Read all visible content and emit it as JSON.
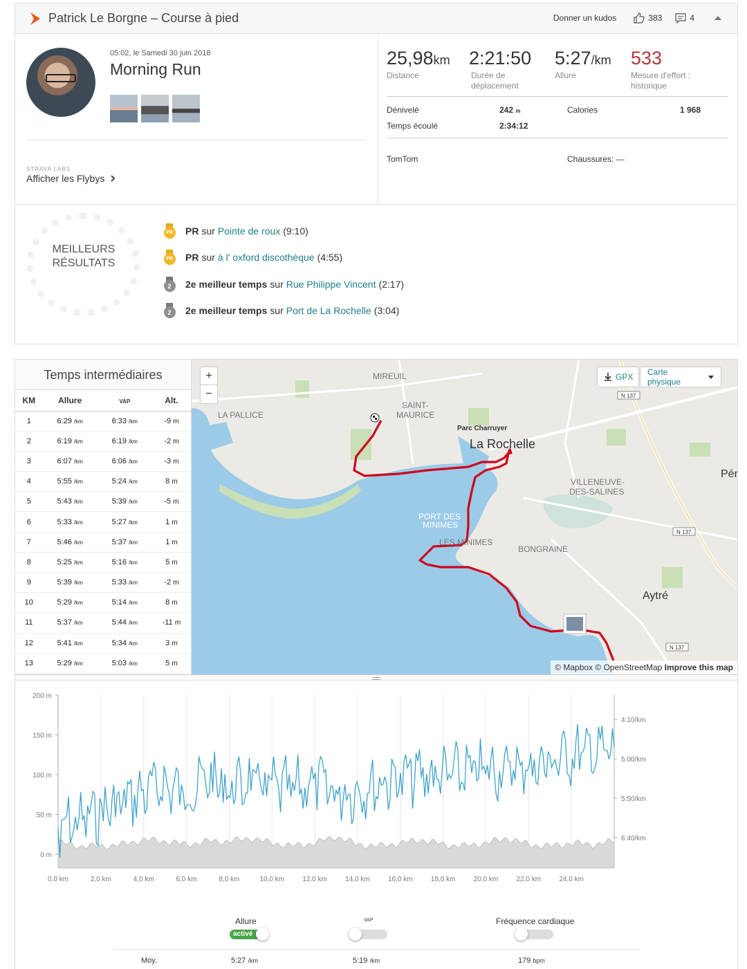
{
  "header": {
    "title": "Patrick Le Borgne – Course à pied",
    "kudos_label": "Donner un kudos",
    "kudos_count": "383",
    "comments_count": "4"
  },
  "activity": {
    "date": "05:02, le Samedi 30 juin 2018",
    "title": "Morning Run",
    "labs_label": "STRAVA LABS",
    "flybys_label": "Afficher les Flybys"
  },
  "stats": {
    "distance": {
      "value": "25,98",
      "unit": "km",
      "label": "Distance"
    },
    "moving_time": {
      "value": "2:21:50",
      "label": "Durée de déplacement"
    },
    "pace": {
      "value": "5:27",
      "unit": "/km",
      "label": "Allure"
    },
    "effort": {
      "value": "533",
      "label": "Mesure d'effort : historique"
    },
    "elevation": {
      "label": "Dénivelé",
      "value": "242",
      "unit": "m"
    },
    "elapsed": {
      "label": "Temps écoulé",
      "value": "2:34:12"
    },
    "calories": {
      "label": "Calories",
      "value": "1 968"
    },
    "device": "TomTom",
    "shoes": "Chaussures: —"
  },
  "best_results": {
    "label_line1": "MEILLEURS",
    "label_line2": "RÉSULTATS",
    "items": [
      {
        "medal": "PR",
        "type": "gold",
        "bold": "PR",
        "sur": "sur",
        "segment": "Pointe de roux",
        "time": "(9:10)"
      },
      {
        "medal": "PR",
        "type": "gold",
        "bold": "PR",
        "sur": "sur",
        "segment": "à l' oxford discothèque",
        "time": "(4:55)"
      },
      {
        "medal": "2",
        "type": "silver",
        "bold": "2e meilleur temps",
        "sur": "sur",
        "segment": "Rue Philippe Vincent",
        "time": "(2:17)"
      },
      {
        "medal": "2",
        "type": "silver",
        "bold": "2e meilleur temps",
        "sur": "sur",
        "segment": "Port de La Rochelle",
        "time": "(3:04)"
      }
    ]
  },
  "splits": {
    "title": "Temps intermédiaires",
    "headers": [
      "KM",
      "Allure",
      "VAP",
      "Alt."
    ],
    "rows": [
      [
        "1",
        "6:29",
        "6:33",
        "-9"
      ],
      [
        "2",
        "6:19",
        "6:19",
        "-2"
      ],
      [
        "3",
        "6:07",
        "6:06",
        "-3"
      ],
      [
        "4",
        "5:55",
        "5:24",
        "8"
      ],
      [
        "5",
        "5:43",
        "5:39",
        "-5"
      ],
      [
        "6",
        "5:33",
        "5:27",
        "1"
      ],
      [
        "7",
        "5:46",
        "5:37",
        "1"
      ],
      [
        "8",
        "5:25",
        "5:16",
        "5"
      ],
      [
        "9",
        "5:39",
        "5:33",
        "-2"
      ],
      [
        "10",
        "5:29",
        "5:14",
        "8"
      ],
      [
        "11",
        "5:37",
        "5:44",
        "-11"
      ],
      [
        "12",
        "5:41",
        "5:34",
        "3"
      ],
      [
        "13",
        "5:29",
        "5:03",
        "5"
      ]
    ],
    "pace_unit": "/km",
    "alt_unit": "m"
  },
  "map": {
    "zoom_in": "+",
    "zoom_out": "−",
    "gpx_label": "GPX",
    "map_type_label": "Carte physique",
    "attribution_mapbox": "© Mapbox",
    "attribution_osm": "© OpenStreetMap",
    "attribution_improve": "Improve this map",
    "places": {
      "mireuil": "MIREUIL",
      "saint": "SAINT-",
      "maurice": "MAURICE",
      "pallice": "LA PALLICE",
      "parc": "Parc Charruyer",
      "rochelle": "La Rochelle",
      "villeneuve": "VILLENEUVE-",
      "salines": "DES-SALINES",
      "port": "PORT DES",
      "minimes_port": "MINIMES",
      "minimes": "LES MINIMES",
      "bongraine": "BONGRAINE",
      "aytre": "Aytré",
      "per": "Pér",
      "n137": "N 137"
    }
  },
  "chart": {
    "left_ticks": [
      "200 m",
      "150 m",
      "100 m",
      "50 m",
      "0 m"
    ],
    "right_ticks": [
      "4:10/km",
      "5:00/km",
      "5:50/km",
      "6:40/km"
    ],
    "x_ticks": [
      "0,0 km",
      "2,0 km",
      "4,0 km",
      "6,0 km",
      "8,0 km",
      "10,0 km",
      "12,0 km",
      "14,0 km",
      "16,0 km",
      "18,0 km",
      "20,0 km",
      "22,0 km",
      "24,0 km"
    ]
  },
  "chart_data": {
    "type": "line",
    "x_unit": "km",
    "xlim": [
      0,
      26
    ],
    "ylim_elevation": [
      0,
      200
    ],
    "series": [
      {
        "name": "Allure",
        "axis": "right",
        "color": "#3fa2c8",
        "x": [
          0,
          1,
          2,
          3,
          4,
          5,
          6,
          7,
          8,
          9,
          10,
          11,
          12,
          13,
          14,
          15,
          16,
          17,
          18,
          19,
          20,
          21,
          22,
          23,
          24,
          25,
          26
        ],
        "values": [
          "6:29",
          "6:19",
          "6:07",
          "5:55",
          "5:43",
          "5:33",
          "5:46",
          "5:25",
          "5:39",
          "5:29",
          "5:37",
          "5:41",
          "5:29",
          "5:45",
          "5:40",
          "5:30",
          "5:25",
          "5:20",
          "5:22",
          "5:18",
          "5:15",
          "5:12",
          "5:10",
          "5:05",
          "4:55",
          "4:50",
          "4:52"
        ]
      },
      {
        "name": "Altitude",
        "axis": "left",
        "color": "#cccccc",
        "x": [
          0,
          1,
          2,
          3,
          4,
          5,
          6,
          7,
          8,
          9,
          10,
          11,
          12,
          13,
          14,
          15,
          16,
          17,
          18,
          19,
          20,
          21,
          22,
          23,
          24,
          25,
          26
        ],
        "values": [
          15,
          10,
          10,
          12,
          18,
          16,
          12,
          16,
          16,
          20,
          14,
          10,
          14,
          22,
          12,
          10,
          14,
          18,
          12,
          10,
          14,
          20,
          12,
          10,
          14,
          12,
          16
        ]
      }
    ]
  },
  "legend": {
    "pace_label": "Allure",
    "pace_toggle": "activé",
    "gap_label": "VAP",
    "hr_label": "Fréquence cardiaque",
    "moy_label": "Moy.",
    "moy_pace": "5:27",
    "moy_gap": "5:19",
    "moy_hr": "179",
    "pace_unit": "/km",
    "hr_unit": "bpm"
  }
}
